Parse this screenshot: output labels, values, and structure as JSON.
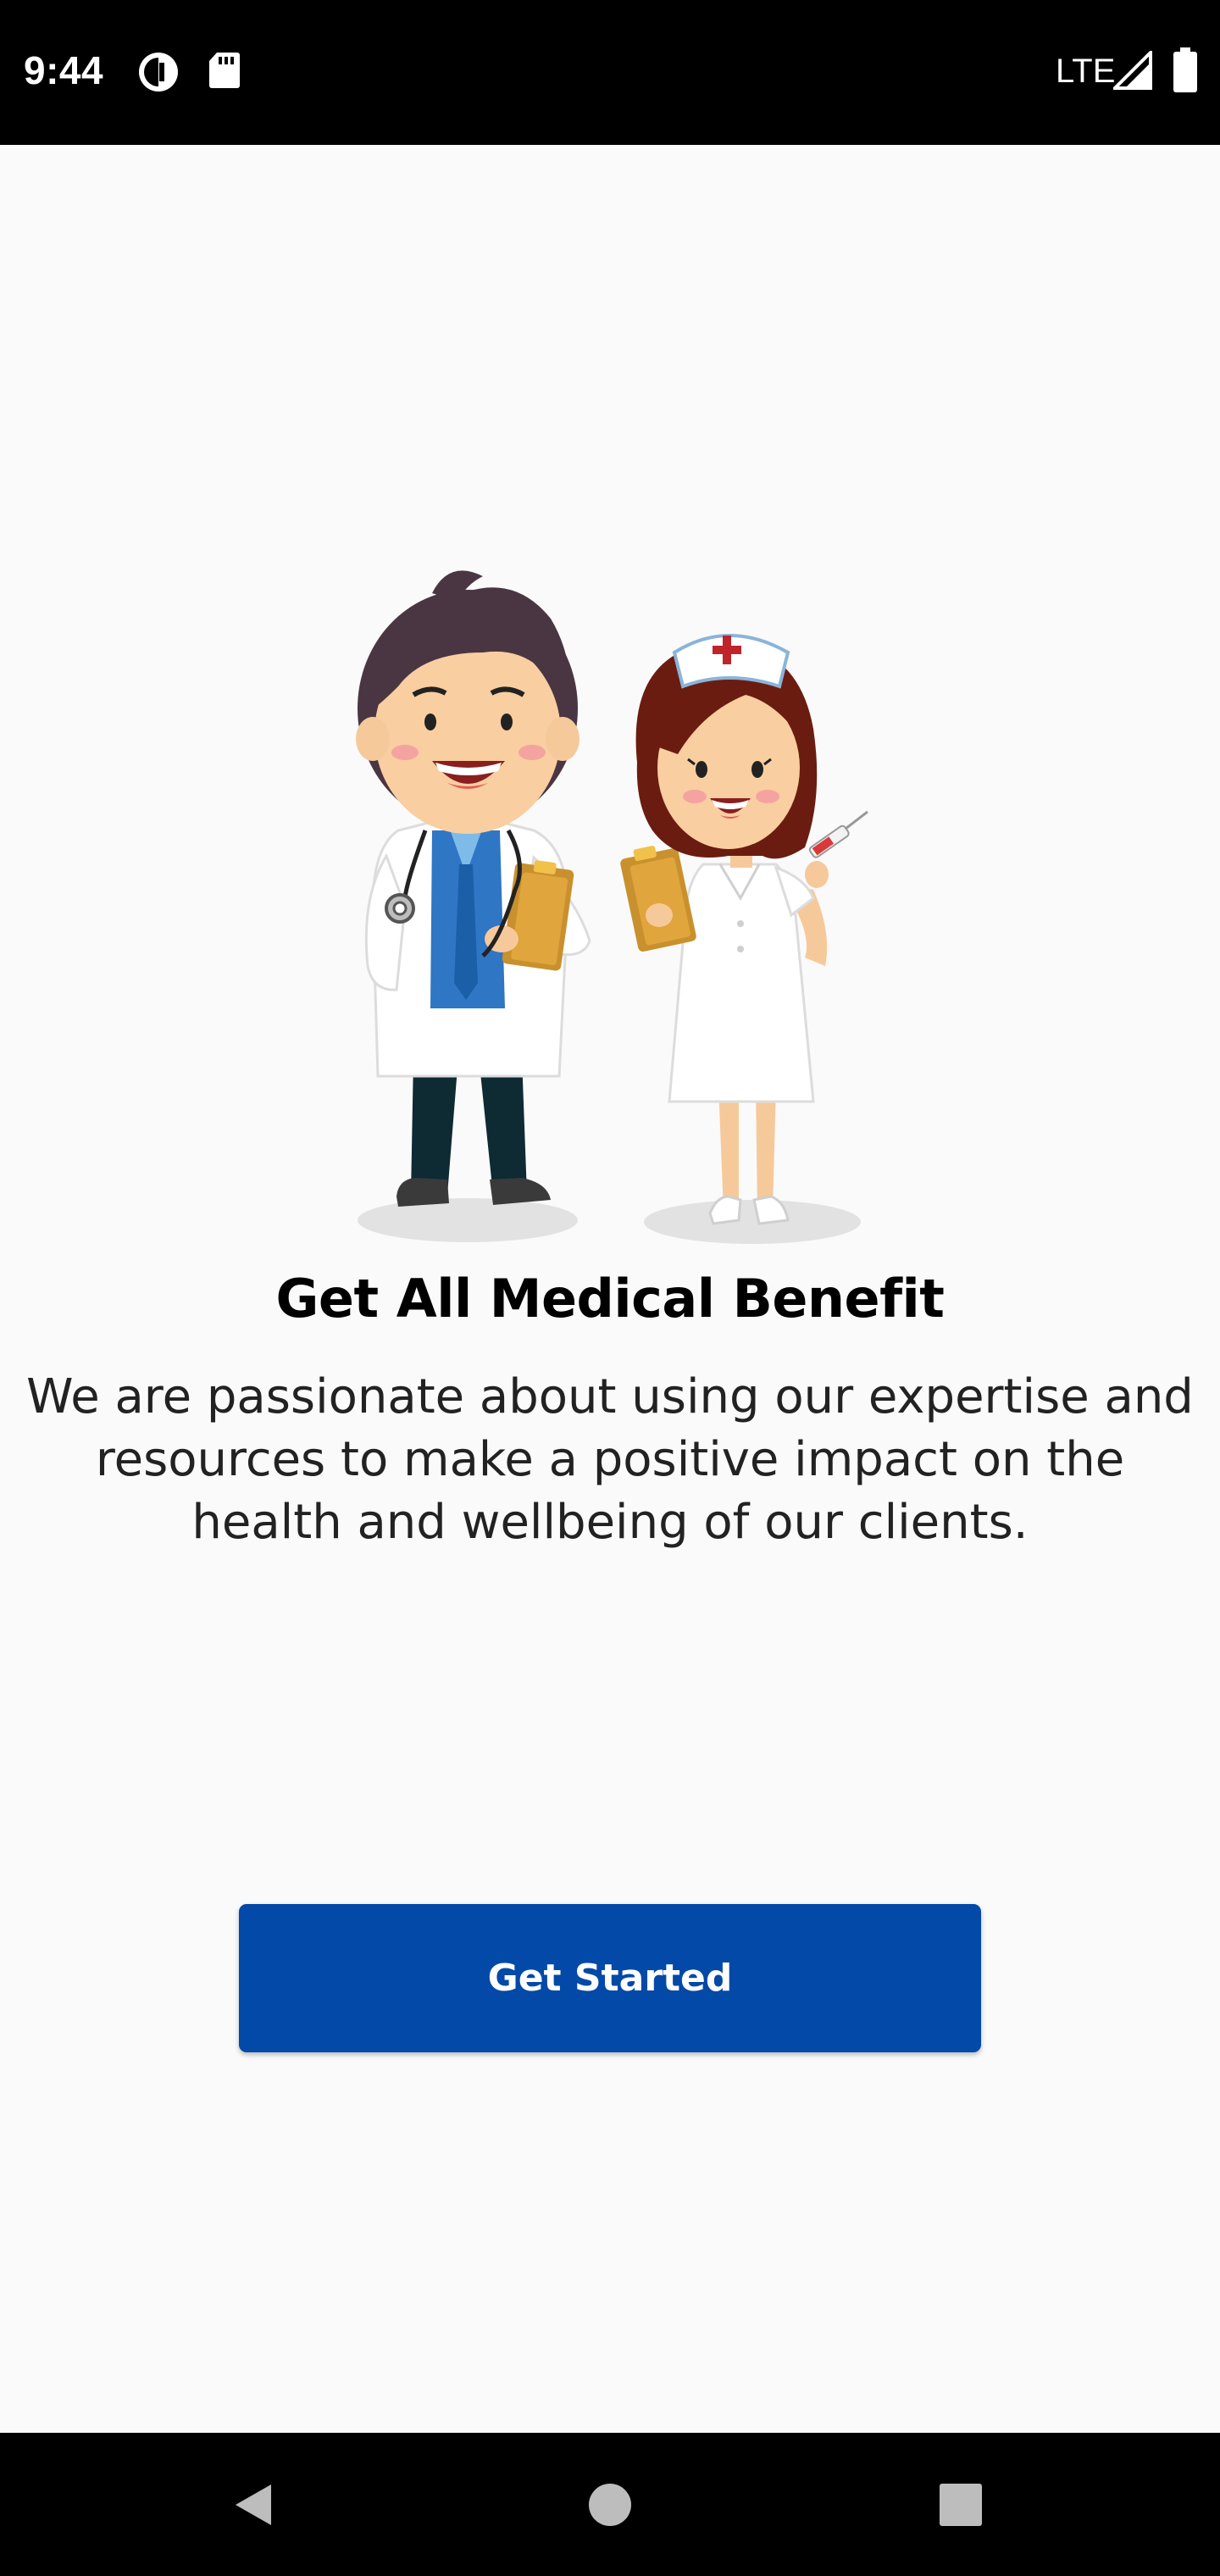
{
  "status_bar": {
    "time": "9:44",
    "network": "LTE",
    "icons": [
      "data-saver-icon",
      "sd-card-icon",
      "signal-icon",
      "battery-icon"
    ]
  },
  "onboarding": {
    "illustration": "doctor-and-nurse-illustration",
    "title": "Get All Medical Benefit",
    "description": "We are passionate about using our expertise and resources to make a positive impact on the health and wellbeing of our clients.",
    "cta_label": "Get Started"
  },
  "nav_bar": {
    "buttons": [
      "back-icon",
      "home-icon",
      "recents-icon"
    ]
  },
  "colors": {
    "primary": "#0349a8",
    "background": "#fafafa",
    "system_bars": "#000000"
  }
}
